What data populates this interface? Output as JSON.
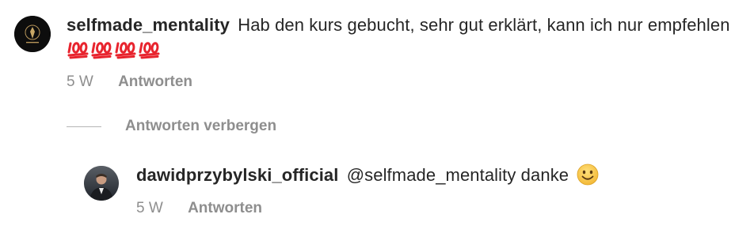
{
  "comments": [
    {
      "username": "selfmade_mentality",
      "text": "Hab den kurs gebucht, sehr gut erklärt, kann ich nur empfehlen",
      "emoji": "100-emoji",
      "emoji_count": 4,
      "age": "5 W",
      "reply_label": "Antworten"
    },
    {
      "username": "dawidprzybylski_official",
      "text": "@selfmade_mentality danke",
      "emoji": "smiling-face-emoji",
      "age": "5 W",
      "reply_label": "Antworten"
    }
  ],
  "hide_replies_label": "Antworten verbergen",
  "colors": {
    "primary_text": "#262626",
    "secondary_text": "#8e8e8e",
    "divider": "#b5b5b5",
    "emoji_red": "#e8242e"
  }
}
